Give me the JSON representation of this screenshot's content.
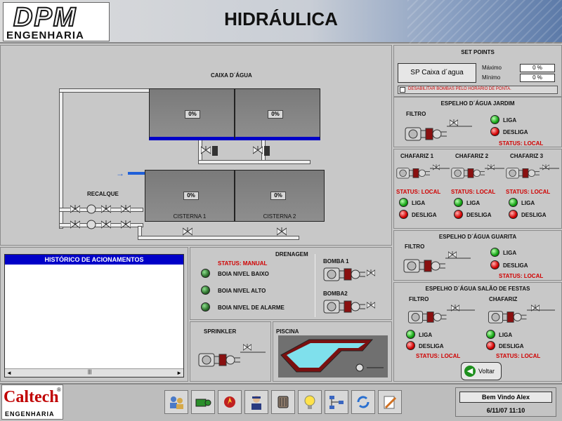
{
  "header": {
    "logo_big": "DPM",
    "logo_small": "ENGENHARIA",
    "title": "HIDRÁULICA"
  },
  "hydraulic": {
    "caixa_label": "CAIXA D´ÁGUA",
    "caixa_tanks": [
      "0%",
      "0%"
    ],
    "cisterna_tanks": [
      {
        "value": "0%",
        "name": "CISTERNA 1"
      },
      {
        "value": "0%",
        "name": "CISTERNA 2"
      }
    ],
    "recalque_label": "RECALQUE",
    "flow_arrow": "→"
  },
  "historico": {
    "title": "HISTÓRICO DE ACIONAMENTOS",
    "scroll_left": "◄",
    "scroll_right": "►",
    "scroll_grip": "|||"
  },
  "drenagem": {
    "title": "DRENAGEM",
    "status": "STATUS: MANUAL",
    "items": [
      "BOIA NIVEL BAIXO",
      "BOIA NIVEL ALTO",
      "BOIA NIVEL DE ALARME"
    ],
    "bomba1": "BOMBA 1",
    "bomba2": "BOMBA2"
  },
  "sprinkler": {
    "title": "SPRINKLER"
  },
  "piscina": {
    "title": "PISCINA"
  },
  "setpoints": {
    "title": "SET POINTS",
    "sp_label": "SP Caixa d´agua",
    "max_label": "Máximo",
    "min_label": "Mínimo",
    "max_value": "0 %",
    "min_value": "0 %",
    "disable_label": "DESABILITAR BOMBAS PELO HORÁRIO DE PONTA."
  },
  "jardim": {
    "title": "ESPELHO D´ÁGUA JARDIM",
    "filtro": "FILTRO",
    "liga": "LIGA",
    "desliga": "DESLIGA",
    "status": "STATUS: LOCAL"
  },
  "chafarizes": [
    {
      "title": "CHAFARIZ 1",
      "status": "STATUS: LOCAL",
      "liga": "LIGA",
      "desliga": "DESLIGA"
    },
    {
      "title": "CHAFARIZ 2",
      "status": "STATUS: LOCAL",
      "liga": "LIGA",
      "desliga": "DESLIGA"
    },
    {
      "title": "CHAFARIZ 3",
      "status": "STATUS: LOCAL",
      "liga": "LIGA",
      "desliga": "DESLIGA"
    }
  ],
  "guarita": {
    "title": "ESPELHO D´ÁGUA GUARITA",
    "filtro": "FILTRO",
    "liga": "LIGA",
    "desliga": "DESLIGA",
    "status": "STATUS: LOCAL"
  },
  "festas": {
    "title": "ESPELHO D´ÁGUA SALÃO DE FESTAS",
    "filtro": "FILTRO",
    "chafariz": "CHAFARIZ",
    "liga": "LIGA",
    "desliga": "DESLIGA",
    "status": "STATUS: LOCAL"
  },
  "voltar": "Voltar",
  "footer": {
    "brand": "Caltech",
    "brand_reg": "®",
    "brand_sub": "ENGENHARIA",
    "welcome": "Bem Vindo Alex",
    "datetime": "6/11/07 11:10",
    "toolbar_icons": [
      "users-icon",
      "pump-icon",
      "fire-alarm-icon",
      "security-guard-icon",
      "motor-icon",
      "lightbulb-icon",
      "network-icon",
      "refresh-icon",
      "notes-icon"
    ]
  },
  "colors": {
    "water": "#0000c8",
    "liga": "#13a313",
    "desliga": "#d40000",
    "status_red": "#d00000",
    "historico_header": "#0000c8"
  }
}
